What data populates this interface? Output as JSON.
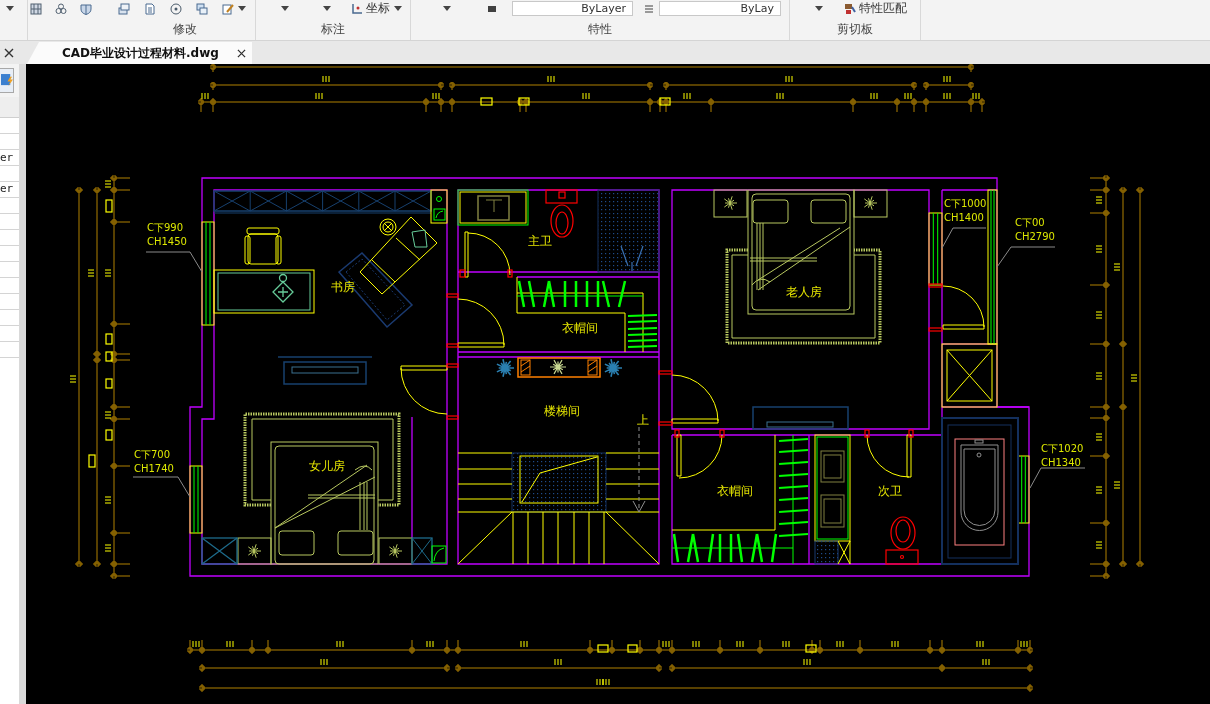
{
  "ribbon": {
    "coordinate_tool": "坐标",
    "linetype_field": "ByLayer",
    "lineweight_field": "ByLay",
    "match_properties_tool": "特性匹配",
    "group_labels": [
      "修改",
      "标注",
      "特性",
      "剪切板"
    ]
  },
  "document_tabs": [
    {
      "label": "CAD毕业设计过程材料.dwg",
      "selected": true
    }
  ],
  "properties_panel": {
    "values": [
      "er",
      "er"
    ]
  },
  "floor_plan": {
    "rooms": [
      "书房",
      "主卫",
      "衣帽间",
      "楼梯间",
      "老人房",
      "女儿房",
      "衣帽间",
      "次卫"
    ],
    "stair_direction": "上",
    "window_tags": [
      {
        "sill": "C下990",
        "height": "CH1450"
      },
      {
        "sill": "C下700",
        "height": "CH1740"
      },
      {
        "sill": "C下1000",
        "height": "CH1400"
      },
      {
        "sill": "C下00",
        "height": "CH2790"
      },
      {
        "sill": "C下1020",
        "height": "CH1340"
      }
    ]
  }
}
